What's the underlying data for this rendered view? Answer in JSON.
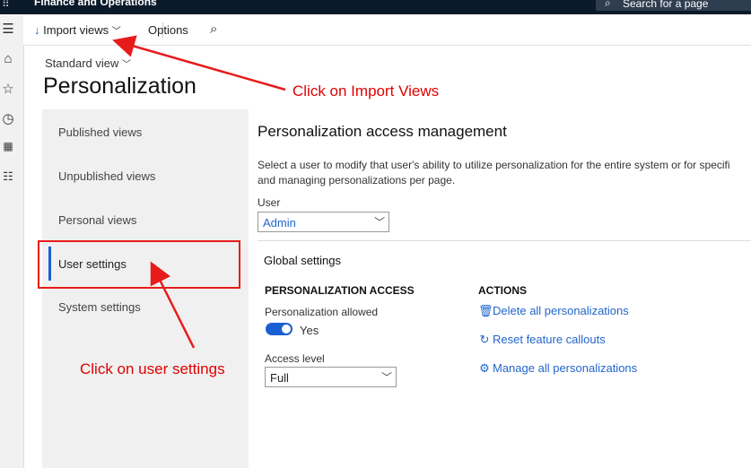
{
  "topbar": {
    "app_name": "Finance and Operations",
    "search_placeholder": "Search for a page"
  },
  "actionbar": {
    "import_views": "Import views",
    "options": "Options"
  },
  "view_selector": "Standard view",
  "page_title": "Personalization",
  "tabs": [
    {
      "label": "Published views",
      "active": false
    },
    {
      "label": "Unpublished views",
      "active": false
    },
    {
      "label": "Personal views",
      "active": false
    },
    {
      "label": "User settings",
      "active": true
    },
    {
      "label": "System settings",
      "active": false
    }
  ],
  "section": {
    "title": "Personalization access management",
    "description_line1": "Select a user to modify that user's ability to utilize personalization for the entire system or for specifi",
    "description_line2": "and managing personalizations per page.",
    "user_label": "User",
    "user_value": "Admin"
  },
  "global_settings": {
    "title": "Global settings",
    "access_header": "PERSONALIZATION ACCESS",
    "allowed_label": "Personalization allowed",
    "allowed_value": "Yes",
    "allowed_on": true,
    "access_level_label": "Access level",
    "access_level_value": "Full",
    "actions_header": "ACTIONS",
    "actions": [
      {
        "label": "Delete all personalizations",
        "icon": "trash-icon"
      },
      {
        "label": "Reset feature callouts",
        "icon": "refresh-icon"
      },
      {
        "label": "Manage all personalizations",
        "icon": "gear-icon"
      }
    ]
  },
  "annotations": {
    "import_hint": "Click on Import Views",
    "user_settings_hint": "Click on user settings",
    "color": "#e00000"
  },
  "colors": {
    "accent": "#1a5fd0",
    "link": "#2266cc",
    "topbar": "#0b1a2a"
  }
}
